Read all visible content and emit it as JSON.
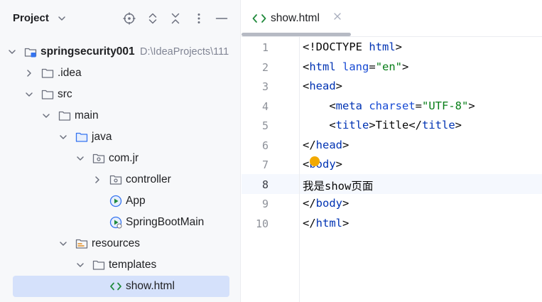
{
  "panel": {
    "title": "Project"
  },
  "tree": [
    {
      "label": "springsecurity001",
      "path": "D:\\IdeaProjects\\111",
      "icon": "module-folder-icon",
      "arrow": "down",
      "bold": true
    },
    {
      "label": ".idea",
      "icon": "folder-icon",
      "arrow": "right"
    },
    {
      "label": "src",
      "icon": "folder-icon",
      "arrow": "down"
    },
    {
      "label": "main",
      "icon": "folder-icon",
      "arrow": "down"
    },
    {
      "label": "java",
      "icon": "source-folder-icon",
      "arrow": "down"
    },
    {
      "label": "com.jr",
      "icon": "package-icon",
      "arrow": "down"
    },
    {
      "label": "controller",
      "icon": "package-icon",
      "arrow": "right"
    },
    {
      "label": "App",
      "icon": "spring-class-icon",
      "arrow": ""
    },
    {
      "label": "SpringBootMain",
      "icon": "spring-boot-class-icon",
      "arrow": ""
    },
    {
      "label": "resources",
      "icon": "resources-folder-icon",
      "arrow": "down"
    },
    {
      "label": "templates",
      "icon": "folder-icon",
      "arrow": "down"
    },
    {
      "label": "show.html",
      "icon": "html-file-icon",
      "arrow": "",
      "selected": true
    }
  ],
  "editor": {
    "tab_label": "show.html",
    "current_line": 8,
    "lines": [
      {
        "n": "1",
        "tokens": [
          {
            "t": "<!DOCTYPE ",
            "c": "txt"
          },
          {
            "t": "html",
            "c": "tag"
          },
          {
            "t": ">",
            "c": "txt"
          }
        ]
      },
      {
        "n": "2",
        "tokens": [
          {
            "t": "<",
            "c": "txt"
          },
          {
            "t": "html ",
            "c": "tag"
          },
          {
            "t": "lang",
            "c": "attr"
          },
          {
            "t": "=",
            "c": "txt"
          },
          {
            "t": "\"en\"",
            "c": "val"
          },
          {
            "t": ">",
            "c": "txt"
          }
        ]
      },
      {
        "n": "3",
        "tokens": [
          {
            "t": "<",
            "c": "txt"
          },
          {
            "t": "head",
            "c": "tag"
          },
          {
            "t": ">",
            "c": "txt"
          }
        ]
      },
      {
        "n": "4",
        "tokens": [
          {
            "t": "    <",
            "c": "txt"
          },
          {
            "t": "meta ",
            "c": "tag"
          },
          {
            "t": "charset",
            "c": "attr"
          },
          {
            "t": "=",
            "c": "txt"
          },
          {
            "t": "\"UTF-8\"",
            "c": "val"
          },
          {
            "t": ">",
            "c": "txt"
          }
        ]
      },
      {
        "n": "5",
        "tokens": [
          {
            "t": "    <",
            "c": "txt"
          },
          {
            "t": "title",
            "c": "tag"
          },
          {
            "t": ">Title</",
            "c": "txt"
          },
          {
            "t": "title",
            "c": "tag"
          },
          {
            "t": ">",
            "c": "txt"
          }
        ]
      },
      {
        "n": "6",
        "tokens": [
          {
            "t": "</",
            "c": "txt"
          },
          {
            "t": "head",
            "c": "tag"
          },
          {
            "t": ">",
            "c": "txt"
          }
        ]
      },
      {
        "n": "7",
        "tokens": [
          {
            "t": "<",
            "c": "txt"
          },
          {
            "t": "body",
            "c": "tag"
          },
          {
            "t": ">",
            "c": "txt"
          }
        ]
      },
      {
        "n": "8",
        "tokens": [
          {
            "t": "我是show页面",
            "c": "txt"
          }
        ]
      },
      {
        "n": "9",
        "tokens": [
          {
            "t": "</",
            "c": "txt"
          },
          {
            "t": "body",
            "c": "tag"
          },
          {
            "t": ">",
            "c": "txt"
          }
        ]
      },
      {
        "n": "10",
        "tokens": [
          {
            "t": "</",
            "c": "txt"
          },
          {
            "t": "html",
            "c": "tag"
          },
          {
            "t": ">",
            "c": "txt"
          }
        ]
      }
    ]
  }
}
